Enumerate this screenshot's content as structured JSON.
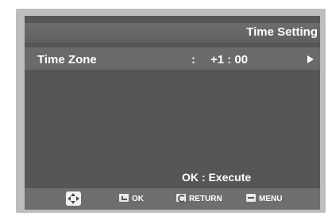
{
  "header": {
    "title": "Time Setting"
  },
  "menu_row": {
    "label": "Time Zone",
    "separator": ":",
    "value": "+1 : 00"
  },
  "hint": "OK : Execute",
  "footer": {
    "ok_label": "OK",
    "return_label": "RETURN",
    "menu_label": "MENU"
  },
  "icons": {
    "nav": "dpad-icon",
    "ok": "ok-icon",
    "return": "return-icon",
    "menu": "menu-icon",
    "arrow": "right-arrow-icon"
  }
}
